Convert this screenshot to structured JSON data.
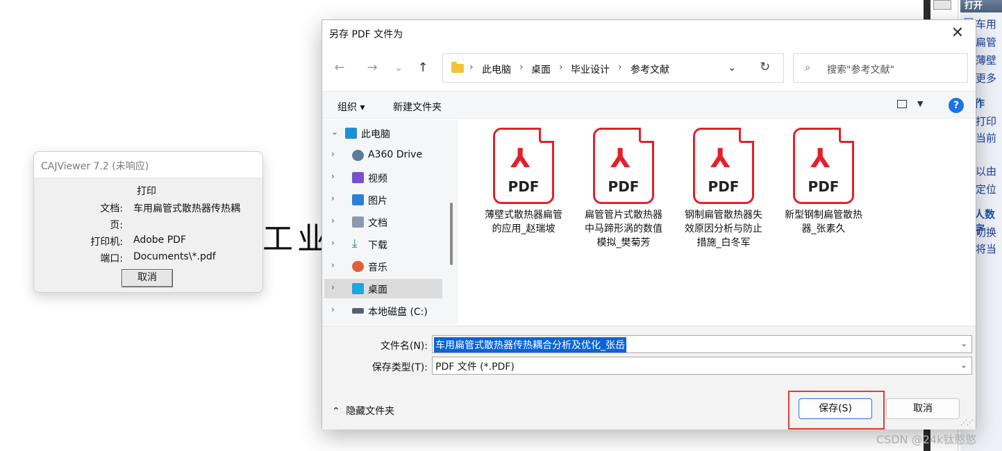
{
  "background": {
    "doc_text": "工业"
  },
  "right_panel": {
    "head": "打开",
    "items_top": [
      "车用",
      "扁管",
      "薄壁",
      "更多"
    ],
    "section_2": "作",
    "items_mid": [
      "打印",
      "当前"
    ],
    "items_mid2": [
      "以由",
      "定位"
    ],
    "section_3": "人数字",
    "items_bottom": [
      "切换",
      "将当"
    ]
  },
  "caj_dialog": {
    "title": "CAJViewer 7.2 (未响应)",
    "heading": "打印",
    "doc_label": "文档:",
    "doc_value": "车用扁管式散热器传热耦",
    "page_label": "页:",
    "printer_label": "打印机:",
    "printer_value": "Adobe PDF",
    "port_label": "端口:",
    "port_value": "Documents\\*.pdf",
    "cancel": "取消"
  },
  "save_dialog": {
    "title": "另存 PDF 文件为",
    "close": "✕",
    "nav": {
      "back": "←",
      "forward": "→",
      "recent": "⌄",
      "up": "↑"
    },
    "breadcrumb": [
      "此电脑",
      "桌面",
      "毕业设计",
      "参考文献"
    ],
    "breadcrumb_sep": "›",
    "search_placeholder": "搜索\"参考文献\"",
    "toolbar": {
      "organize": "组织 ▾",
      "new_folder": "新建文件夹",
      "help": "?"
    },
    "tree": [
      {
        "label": "此电脑",
        "chev": "⌄",
        "icon_color": "#1e90d6"
      },
      {
        "label": "A360 Drive",
        "chev": "›",
        "icon_color": "#5a7d95"
      },
      {
        "label": "视频",
        "chev": "›",
        "icon_color": "#7b4fd1"
      },
      {
        "label": "图片",
        "chev": "›",
        "icon_color": "#2b7fd6"
      },
      {
        "label": "文档",
        "chev": "›",
        "icon_color": "#8a9bb0"
      },
      {
        "label": "下载",
        "chev": "›",
        "icon_color": "#22a06b"
      },
      {
        "label": "音乐",
        "chev": "›",
        "icon_color": "#e0603a"
      },
      {
        "label": "桌面",
        "chev": "›",
        "icon_color": "#1aa6e0"
      },
      {
        "label": "本地磁盘 (C:)",
        "chev": "›",
        "icon_color": "#556070"
      }
    ],
    "files": [
      {
        "name": "薄壁式散热器扁管的应用_赵瑞坡",
        "type_label": "PDF"
      },
      {
        "name": "扁管管片式散热器中马蹄形涡的数值模拟_樊菊芳",
        "type_label": "PDF"
      },
      {
        "name": "钢制扁管散热器失效原因分析与防止措施_白冬军",
        "type_label": "PDF"
      },
      {
        "name": "新型钢制扁管散热器_张素久",
        "type_label": "PDF"
      }
    ],
    "filename_label": "文件名(N):",
    "filename_value": "车用扁管式散热器传热耦合分析及优化_张岳",
    "filetype_label": "保存类型(T):",
    "filetype_value": "PDF 文件 (*.PDF)",
    "hide_folders": "隐藏文件夹",
    "save_button": "保存(S)",
    "cancel_button": "取消"
  },
  "watermark": "CSDN @24k钛憨憨"
}
